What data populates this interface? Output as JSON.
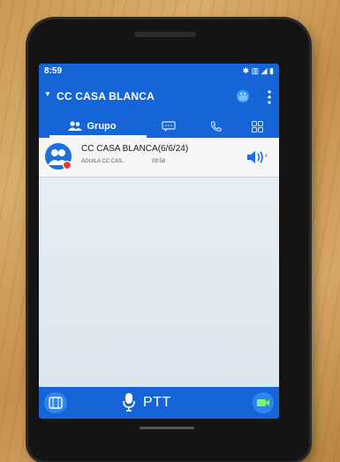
{
  "status_bar": {
    "time": "8:59",
    "icons_text": "✱ ▥ ◢ ▮"
  },
  "app_bar": {
    "title": "CC CASA BLANCA"
  },
  "tabs": [
    {
      "label": "Grupo",
      "icon": "group-icon",
      "active": true
    },
    {
      "label": "",
      "icon": "chat-icon",
      "active": false
    },
    {
      "label": "",
      "icon": "phone-icon",
      "active": false
    },
    {
      "label": "",
      "icon": "grid-icon",
      "active": false
    }
  ],
  "list": [
    {
      "title": "CC CASA BLANCA(6/6/24)",
      "subtitle": "AGUILA CC CAS..",
      "time": "09:58"
    }
  ],
  "bottom_bar": {
    "ptt_label": "PTT"
  },
  "colors": {
    "primary": "#1565d8",
    "accent": "#2f86f0",
    "list_bg": "#f5f6f8"
  }
}
